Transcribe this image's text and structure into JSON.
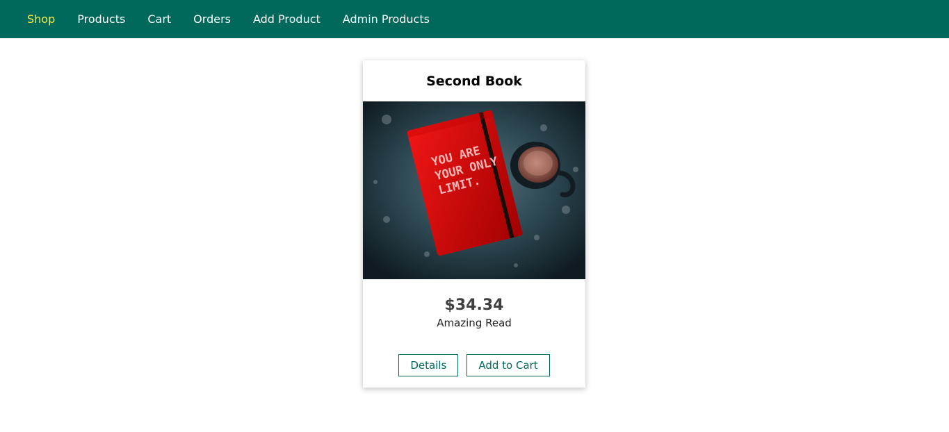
{
  "nav": {
    "items": [
      {
        "label": "Shop"
      },
      {
        "label": "Products"
      },
      {
        "label": "Cart"
      },
      {
        "label": "Orders"
      },
      {
        "label": "Add Product"
      },
      {
        "label": "Admin Products"
      }
    ]
  },
  "product": {
    "title": "Second Book",
    "image_text": [
      "YOU ARE",
      "YOUR ONLY",
      "LIMIT."
    ],
    "price": "$34.34",
    "description": "Amazing Read",
    "details_label": "Details",
    "add_to_cart_label": "Add to Cart"
  },
  "colors": {
    "nav_bg": "#00695c",
    "nav_active": "#ffeb3b",
    "button_accent": "#00695c"
  }
}
